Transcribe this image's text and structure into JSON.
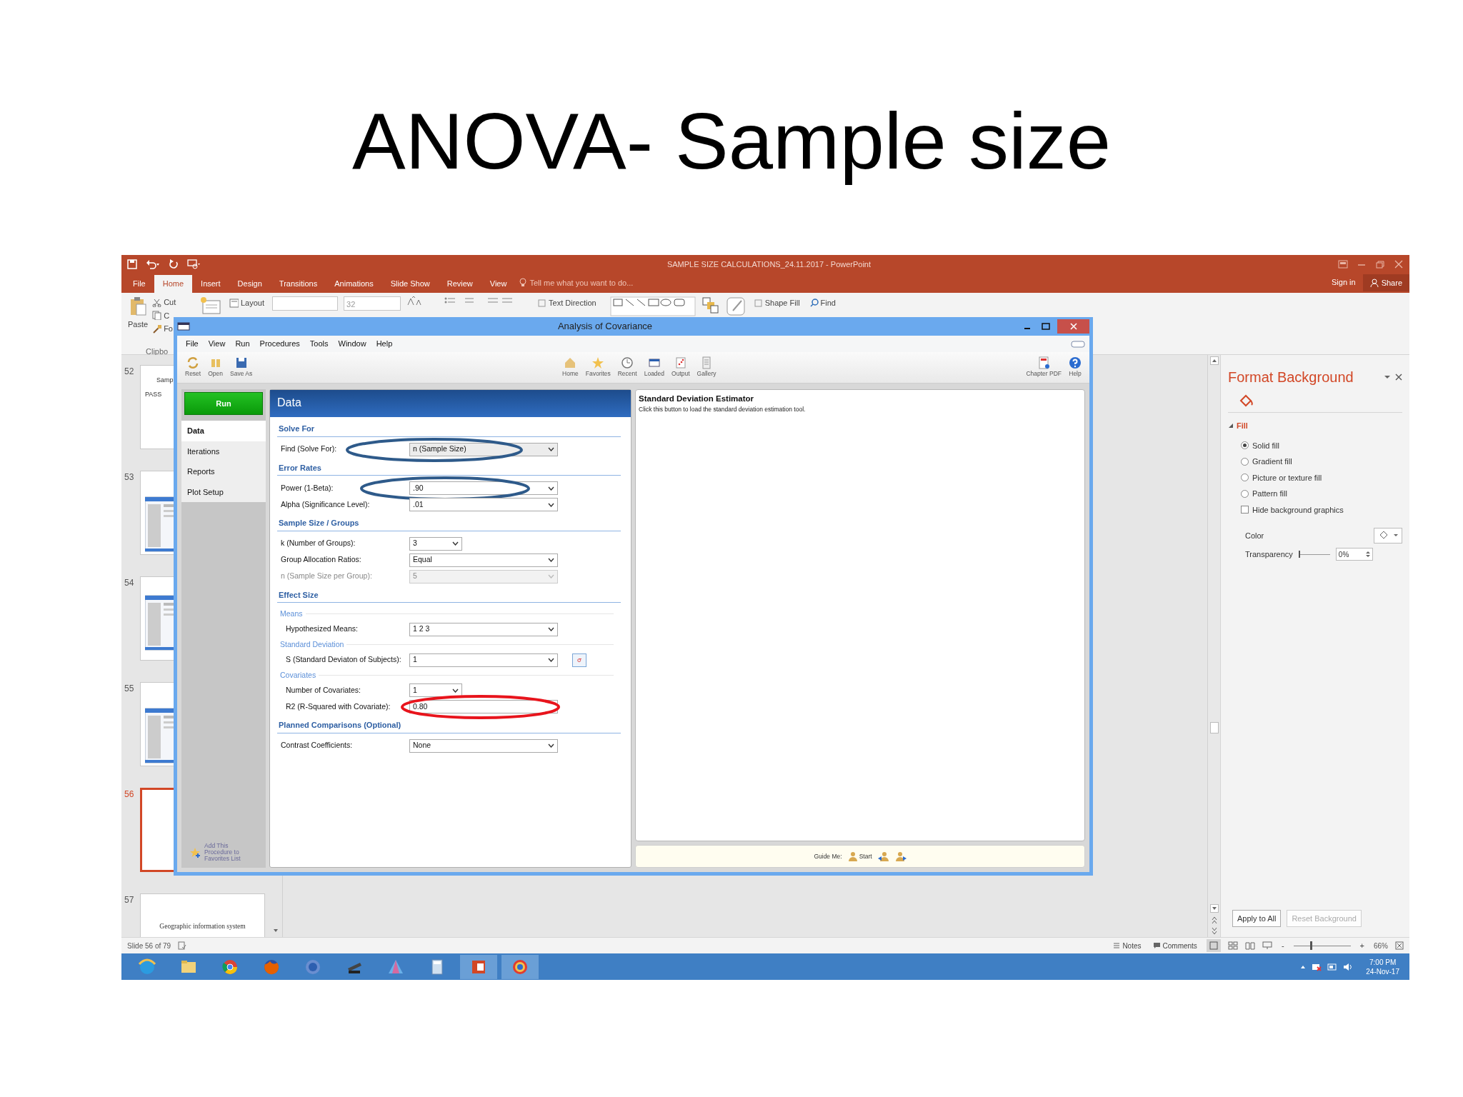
{
  "slide": {
    "title": "ANOVA- Sample size"
  },
  "ppt": {
    "title": "SAMPLE SIZE CALCULATIONS_24.11.2017 - PowerPoint",
    "tabs": [
      {
        "label": "File",
        "selected": false
      },
      {
        "label": "Home",
        "selected": true
      },
      {
        "label": "Insert",
        "selected": false
      },
      {
        "label": "Design",
        "selected": false
      },
      {
        "label": "Transitions",
        "selected": false
      },
      {
        "label": "Animations",
        "selected": false
      },
      {
        "label": "Slide Show",
        "selected": false
      },
      {
        "label": "Review",
        "selected": false
      },
      {
        "label": "View",
        "selected": false
      }
    ],
    "tell_me": "Tell me what you want to do...",
    "sign_in": "Sign in",
    "share": "Share",
    "clipboard": {
      "paste": "Paste",
      "small": [
        "Cut",
        "C",
        "Fo"
      ],
      "group": "Clipbo"
    },
    "ribbon": [
      {
        "kind": "small",
        "label": "Layout"
      },
      {
        "kind": "combo"
      },
      {
        "kind": "combo",
        "value": "32"
      },
      {
        "kind": "small",
        "label": "Text Direction"
      },
      {
        "kind": "shapes"
      },
      {
        "kind": "small",
        "label": "Shape Fill"
      },
      {
        "kind": "find",
        "label": "Find"
      }
    ],
    "thumbnails": [
      {
        "number": "52",
        "selected": false,
        "kind": "text",
        "texts": [
          "Samp",
          "PASS"
        ]
      },
      {
        "number": "53",
        "selected": false,
        "kind": "screenshot"
      },
      {
        "number": "54",
        "selected": false,
        "kind": "screenshot"
      },
      {
        "number": "55",
        "selected": false,
        "kind": "screenshot"
      },
      {
        "number": "56",
        "selected": true,
        "kind": "blank"
      },
      {
        "number": "57",
        "selected": false,
        "kind": "text",
        "texts": [
          "Geographic information system"
        ]
      }
    ],
    "pane": {
      "title": "Format Background",
      "section": "Fill",
      "expanded": true,
      "options": [
        {
          "label": "Solid fill",
          "selected": true
        },
        {
          "label": "Gradient fill",
          "selected": false
        },
        {
          "label": "Picture or texture fill",
          "selected": false
        },
        {
          "label": "Pattern fill",
          "selected": false
        }
      ],
      "hide_graphics": {
        "label": "Hide background graphics",
        "checked": false
      },
      "color_label": "Color",
      "transparency_label": "Transparency",
      "transparency": {
        "level": 0,
        "value": "0%"
      },
      "buttons": [
        {
          "label": "Apply to All",
          "disabled": false
        },
        {
          "label": "Reset Background",
          "disabled": true
        }
      ]
    },
    "status": {
      "slide": "Slide 56 of 79",
      "notes": "Notes",
      "comments": "Comments",
      "zoom_out": "-",
      "zoom_in": "+",
      "zoom": {
        "level": 0.3,
        "value": "66%"
      }
    },
    "taskbar": {
      "time": "7:00 PM",
      "date": "24-Nov-17"
    }
  },
  "pass": {
    "title": "Analysis of Covariance",
    "menu": [
      "File",
      "View",
      "Run",
      "Procedures",
      "Tools",
      "Window",
      "Help"
    ],
    "toolbar_left": [
      "Reset",
      "Open",
      "Save As"
    ],
    "toolbar_mid": [
      "Home",
      "Favorites",
      "Recent",
      "Loaded",
      "Output",
      "Gallery"
    ],
    "toolbar_right": [
      "Chapter PDF",
      "Help"
    ],
    "run": "Run",
    "nav": [
      {
        "label": "Data",
        "selected": true
      },
      {
        "label": "Iterations",
        "selected": false
      },
      {
        "label": "Reports",
        "selected": false
      },
      {
        "label": "Plot Setup",
        "selected": false
      }
    ],
    "favorites": "Add This Procedure to Favorites List",
    "panel_title": "Data",
    "sections": [
      {
        "title": "Solve For",
        "rows": [
          {
            "kind": "combo",
            "label": "Find (Solve For):",
            "value": "n (Sample Size)",
            "disabled": false,
            "circle": {
              "color": "#2e5a8a"
            }
          }
        ]
      },
      {
        "title": "Error Rates",
        "rows": [
          {
            "kind": "dropdown",
            "label": "Power (1-Beta):",
            "value": ".90",
            "disabled": false,
            "circle": {
              "color": "#2e5a8a"
            }
          },
          {
            "kind": "dropdown",
            "label": "Alpha (Significance Level):",
            "value": ".01",
            "disabled": false
          }
        ]
      },
      {
        "title": "Sample Size / Groups",
        "rows": [
          {
            "kind": "short-dropdown",
            "label": "k (Number of Groups):",
            "value": "3",
            "disabled": false
          },
          {
            "kind": "dropdown",
            "label": "Group Allocation Ratios:",
            "value": "Equal",
            "disabled": false
          },
          {
            "kind": "dropdown",
            "label": "n (Sample Size per Group):",
            "value": "5",
            "disabled": true
          }
        ]
      },
      {
        "title": "Effect Size",
        "rows": [
          {
            "kind": "subheading",
            "label": "Means"
          },
          {
            "kind": "dropdown",
            "label": "Hypothesized Means:",
            "value": "1 2 3",
            "disabled": false
          },
          {
            "kind": "subheading",
            "label": "Standard Deviation"
          },
          {
            "kind": "dropdown",
            "label": "S (Standard Deviaton of Subjects):",
            "value": "1",
            "disabled": false,
            "tool_button": true
          },
          {
            "kind": "subheading",
            "label": "Covariates"
          },
          {
            "kind": "short-dropdown",
            "label": "Number of Covariates:",
            "value": "1",
            "disabled": false
          },
          {
            "kind": "text",
            "label": "R2 (R-Squared with Covariate):",
            "value": "0.80",
            "disabled": false,
            "circle": {
              "color": "#e8141c"
            }
          }
        ]
      },
      {
        "title": "Planned Comparisons (Optional)",
        "rows": [
          {
            "kind": "dropdown",
            "label": "Contrast Coefficients:",
            "value": "None",
            "disabled": false
          }
        ]
      }
    ],
    "info": {
      "title": "Standard Deviation Estimator",
      "text": "Click this button to load the standard deviation estimation tool."
    },
    "guide": {
      "label": "Guide Me:",
      "start": "Start"
    }
  }
}
